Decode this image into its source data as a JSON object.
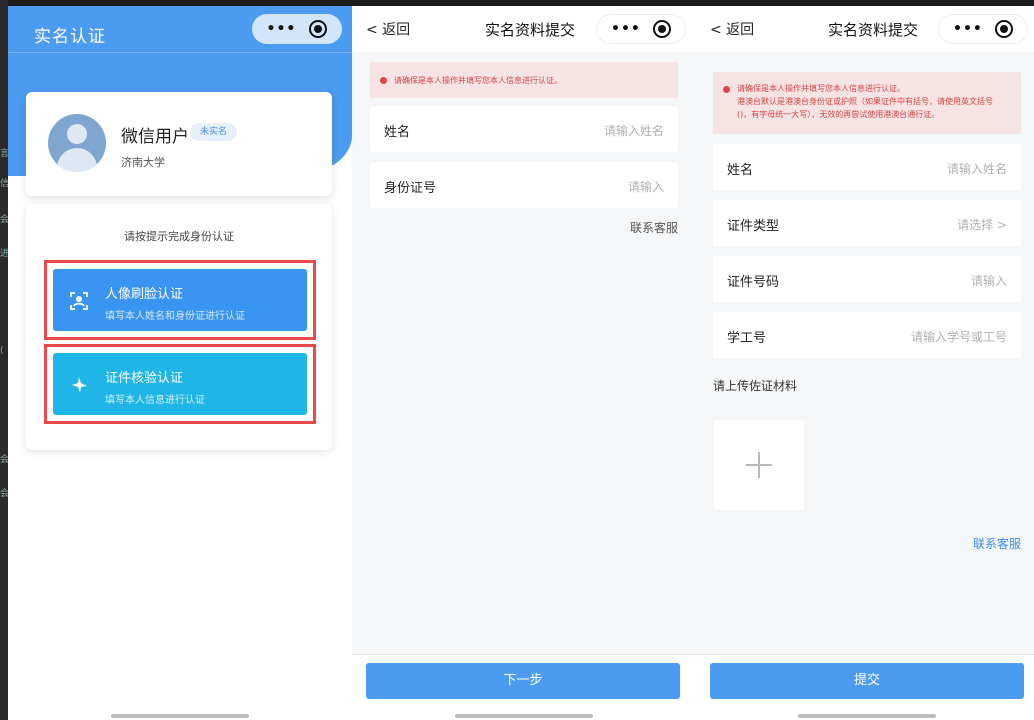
{
  "colors": {
    "accent": "#4b9bf0",
    "teal": "#1fb5e6",
    "warning_red": "#e84a4a",
    "notice_bg": "#f6e3e3"
  },
  "edge_marks": [
    "言",
    "信",
    "会",
    "进",
    "(",
    "会",
    "会"
  ],
  "panel1": {
    "title": "实名认证",
    "user": {
      "name": "微信用户",
      "badge": "未实名",
      "school": "济南大学",
      "avatar_icon": "user-avatar-icon"
    },
    "hint": "请按提示完成身份认证",
    "options": [
      {
        "title": "人像刷脸认证",
        "subtitle": "填写本人姓名和身份证进行认证",
        "icon": "face-scan-icon",
        "color": "#3a95f2"
      },
      {
        "title": "证件核验认证",
        "subtitle": "填写本人信息进行认证",
        "icon": "airplane-icon",
        "color": "#1fb5e6"
      }
    ]
  },
  "panel2": {
    "back": "< 返回",
    "title": "实名资料提交",
    "notice": "请确保是本人操作并填写您本人信息进行认证。",
    "fields": [
      {
        "label": "姓名",
        "placeholder": "请输入姓名"
      },
      {
        "label": "身份证号",
        "placeholder": "请输入"
      }
    ],
    "service_link": "联系客服",
    "next_button": "下一步"
  },
  "panel3": {
    "back": "< 返回",
    "title": "实名资料提交",
    "notice_lines": [
      "请确保是本人操作并填写您本人信息进行认证。",
      "港澳台默认是港澳台身份证或护照（如果证件中有括号，请使用英文括号",
      "()，有字母统一大写），无效的再尝试使用港澳台通行证。"
    ],
    "fields": [
      {
        "label": "姓名",
        "placeholder": "请输入姓名"
      },
      {
        "label": "证件类型",
        "placeholder": "请选择 >"
      },
      {
        "label": "证件号码",
        "placeholder": "请输入"
      },
      {
        "label": "学工号",
        "placeholder": "请输入学号或工号"
      }
    ],
    "upload_label": "请上传佐证材料",
    "service_link": "联系客服",
    "submit_button": "提交"
  }
}
